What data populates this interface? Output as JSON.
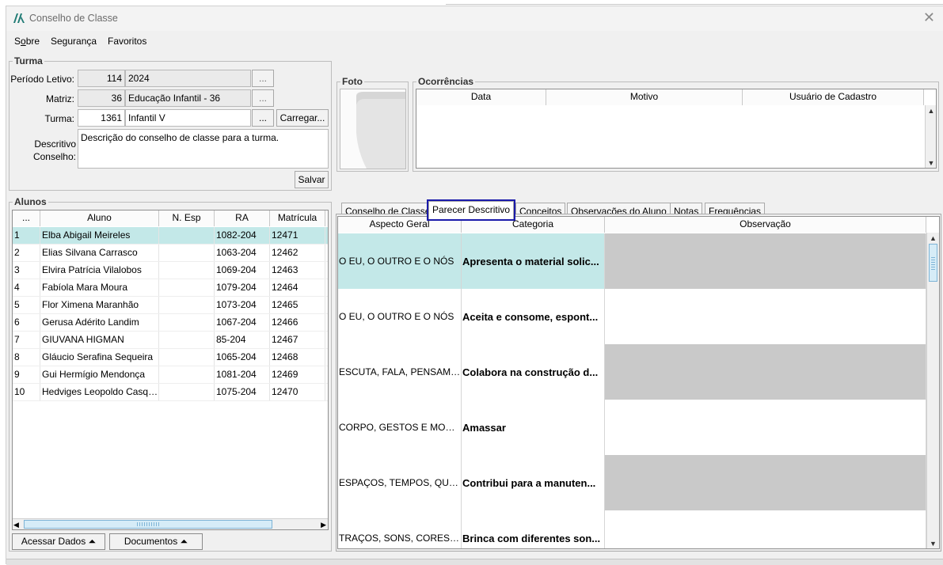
{
  "window": {
    "title": "Conselho de Classe"
  },
  "menu": [
    {
      "label": "Sobre"
    },
    {
      "label": "Segurança"
    },
    {
      "label": "Favoritos"
    }
  ],
  "turma": {
    "legend": "Turma",
    "periodo_label": "Período Letivo:",
    "periodo_code": "114",
    "periodo_value": "2024",
    "matriz_label": "Matriz:",
    "matriz_code": "36",
    "matriz_value": "Educação Infantil - 36",
    "turma_label": "Turma:",
    "turma_code": "1361",
    "turma_value": "Infantil V",
    "browse_label": "...",
    "carregar_label": "Carregar...",
    "descritivo_label_1": "Descritivo",
    "descritivo_label_2": "Conselho:",
    "descritivo_value": "Descrição do conselho de classe para a turma.",
    "salvar_label": "Salvar"
  },
  "foto": {
    "legend": "Foto"
  },
  "ocorrencias": {
    "legend": "Ocorrências",
    "columns": [
      "Data",
      "Motivo",
      "Usuário de Cadastro"
    ]
  },
  "alunos": {
    "legend": "Alunos",
    "columns": [
      "...",
      "Aluno",
      "N. Esp",
      "RA",
      "Matrícula"
    ],
    "rows": [
      {
        "n": "1",
        "nome": "Elba Abigail Meireles",
        "esp": "",
        "ra": "1082-204",
        "mat": "12471"
      },
      {
        "n": "2",
        "nome": "Elias Silvana Carrasco",
        "esp": "",
        "ra": "1063-204",
        "mat": "12462"
      },
      {
        "n": "3",
        "nome": "Elvira Patrícia Vilalobos",
        "esp": "",
        "ra": "1069-204",
        "mat": "12463"
      },
      {
        "n": "4",
        "nome": "Fabíola Mara Moura",
        "esp": "",
        "ra": "1079-204",
        "mat": "12464"
      },
      {
        "n": "5",
        "nome": "Flor Ximena Maranhão",
        "esp": "",
        "ra": "1073-204",
        "mat": "12465"
      },
      {
        "n": "6",
        "nome": "Gerusa Adérito Landim",
        "esp": "",
        "ra": "1067-204",
        "mat": "12466"
      },
      {
        "n": "7",
        "nome": "GIUVANA HIGMAN",
        "esp": "",
        "ra": "85-204",
        "mat": "12467"
      },
      {
        "n": "8",
        "nome": "Gláucio Serafina Sequeira",
        "esp": "",
        "ra": "1065-204",
        "mat": "12468"
      },
      {
        "n": "9",
        "nome": "Gui Hermígio Mendonça",
        "esp": "",
        "ra": "1081-204",
        "mat": "12469"
      },
      {
        "n": "10",
        "nome": "Hedviges Leopoldo Casqu...",
        "esp": "",
        "ra": "1075-204",
        "mat": "12470"
      }
    ]
  },
  "buttons": {
    "acessar_dados": "Acessar Dados ⏶",
    "documentos": "Documentos ⏶"
  },
  "tabs": [
    {
      "label": "Conselho de Classe"
    },
    {
      "label": "Parecer Descritivo"
    },
    {
      "label": "Conceitos"
    },
    {
      "label": "Observações do Aluno"
    },
    {
      "label": "Notas"
    },
    {
      "label": "Frequências"
    }
  ],
  "parecer": {
    "columns": [
      "Aspecto Geral",
      "Categoria",
      "Observação"
    ],
    "rows": [
      {
        "aspecto": "O EU, O OUTRO E O NÓS",
        "categoria": "Apresenta o material solic...",
        "obs": ""
      },
      {
        "aspecto": "O EU, O OUTRO E O NÓS",
        "categoria": "Aceita e consome, espont...",
        "obs": ""
      },
      {
        "aspecto": "ESCUTA, FALA, PENSAMEN...",
        "categoria": "Colabora na construção d...",
        "obs": ""
      },
      {
        "aspecto": "CORPO, GESTOS E MOVIM...",
        "categoria": "Amassar",
        "obs": ""
      },
      {
        "aspecto": "ESPAÇOS, TEMPOS, QUAN...",
        "categoria": "Contribui para a manuten...",
        "obs": ""
      },
      {
        "aspecto": "TRAÇOS, SONS, CORES E F...",
        "categoria": "Brinca com diferentes son...",
        "obs": ""
      }
    ]
  },
  "colors": {
    "selected_row": "#c3e8e8",
    "grey_obs": "#c9c9c9",
    "tab_highlight": "#1a1aaa"
  }
}
